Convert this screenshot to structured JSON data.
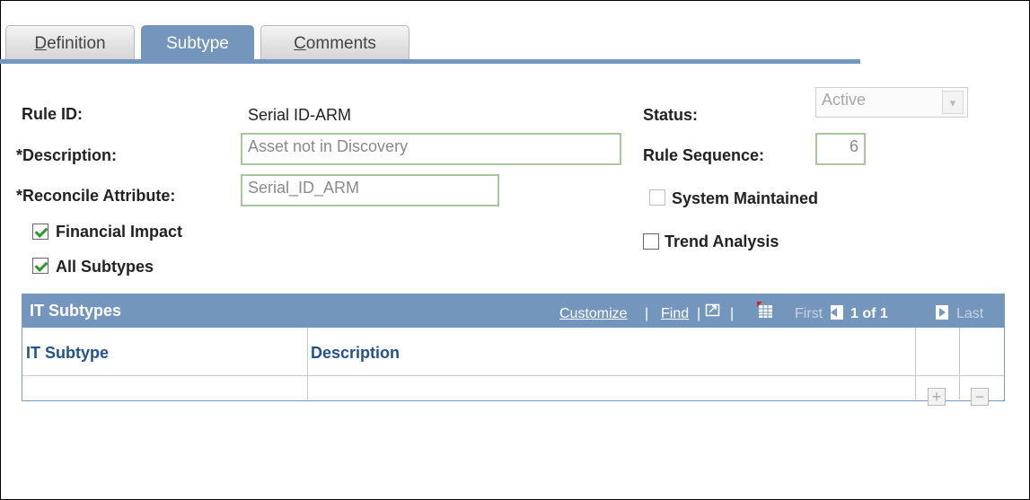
{
  "tabs": [
    {
      "label_underline": "D",
      "label_rest": "efinition"
    },
    {
      "label": "Subtype"
    },
    {
      "label_underline": "C",
      "label_rest": "omments"
    }
  ],
  "form": {
    "rule_id_label": "Rule ID:",
    "rule_id_value": "Serial ID-ARM",
    "description_label": "*Description:",
    "description_value": "Asset not in Discovery",
    "reconcile_label": "*Reconcile Attribute:",
    "reconcile_value": "Serial_ID_ARM",
    "financial_impact_label": "Financial Impact",
    "financial_impact_checked": true,
    "all_subtypes_label": "All Subtypes",
    "all_subtypes_checked": true,
    "status_label": "Status:",
    "status_value": "Active",
    "rule_sequence_label": "Rule Sequence:",
    "rule_sequence_value": "6",
    "system_maintained_label": "System Maintained",
    "system_maintained_checked": false,
    "trend_analysis_label": "Trend Analysis",
    "trend_analysis_checked": false
  },
  "grid": {
    "title": "IT Subtypes",
    "customize": "Customize",
    "find": "Find",
    "sep": "|",
    "first": "First",
    "range": "1 of 1",
    "last": "Last",
    "columns": [
      "IT Subtype",
      "Description"
    ],
    "add_symbol": "+",
    "remove_symbol": "−"
  },
  "icons": {
    "select_arrow": "▾"
  }
}
